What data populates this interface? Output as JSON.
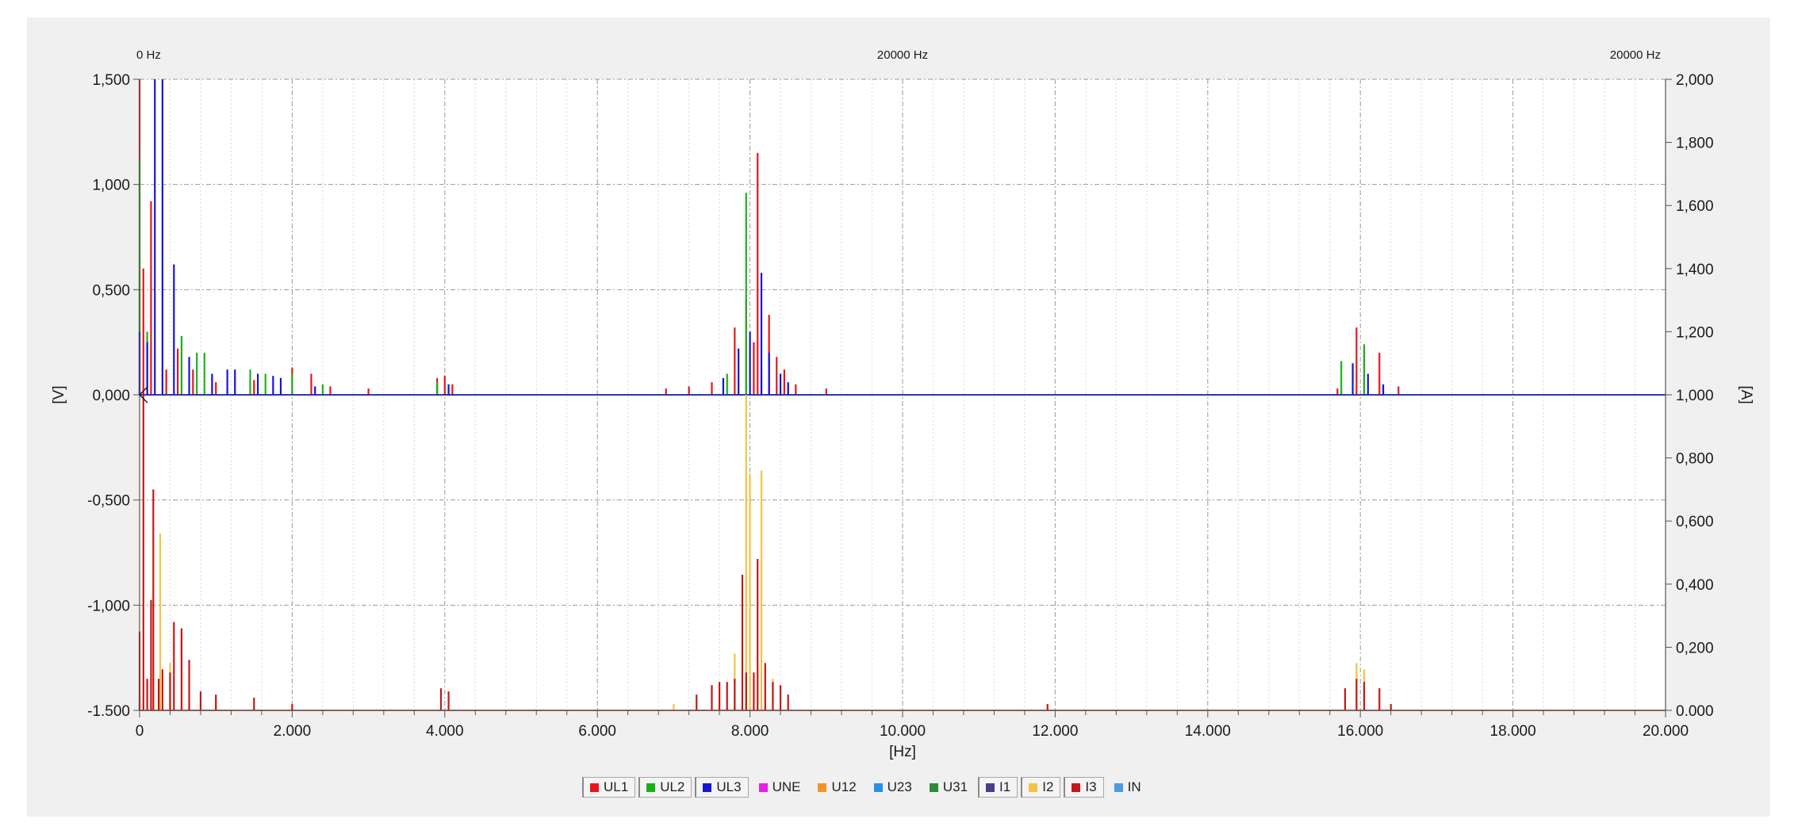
{
  "top_labels": {
    "left": "0 Hz",
    "center": "20000 Hz",
    "right": "20000 Hz"
  },
  "chart_data": {
    "type": "bar",
    "xlabel": "[Hz]",
    "ylabel_left": "[V]",
    "ylabel_right": "[A]",
    "xlim": [
      0,
      20000
    ],
    "ylim_left": [
      -1.5,
      1.5
    ],
    "ylim_right": [
      0,
      2
    ],
    "grid": true,
    "legend_position": "bottom",
    "x_ticks": [
      {
        "value": 0,
        "label": "0"
      },
      {
        "value": 2000,
        "label": "2.000"
      },
      {
        "value": 4000,
        "label": "4.000"
      },
      {
        "value": 6000,
        "label": "6.000"
      },
      {
        "value": 8000,
        "label": "8.000"
      },
      {
        "value": 10000,
        "label": "10.000"
      },
      {
        "value": 12000,
        "label": "12.000"
      },
      {
        "value": 14000,
        "label": "14.000"
      },
      {
        "value": 16000,
        "label": "16.000"
      },
      {
        "value": 18000,
        "label": "18.000"
      },
      {
        "value": 20000,
        "label": "20.000"
      }
    ],
    "y_ticks_left": [
      {
        "value": 1.5,
        "label": "1,500"
      },
      {
        "value": 1.0,
        "label": "1,000"
      },
      {
        "value": 0.5,
        "label": "0,500"
      },
      {
        "value": 0.0,
        "label": "0,000"
      },
      {
        "value": -0.5,
        "label": "-0,500"
      },
      {
        "value": -1.0,
        "label": "-1,000"
      },
      {
        "value": -1.5,
        "label": "-1.500"
      }
    ],
    "y_ticks_right": [
      {
        "value": 2.0,
        "label": "2,000"
      },
      {
        "value": 1.8,
        "label": "1,800"
      },
      {
        "value": 1.6,
        "label": "1,600"
      },
      {
        "value": 1.4,
        "label": "1,400"
      },
      {
        "value": 1.2,
        "label": "1,200"
      },
      {
        "value": 1.0,
        "label": "1,000"
      },
      {
        "value": 0.8,
        "label": "0,800"
      },
      {
        "value": 0.6,
        "label": "0,600"
      },
      {
        "value": 0.4,
        "label": "0,400"
      },
      {
        "value": 0.2,
        "label": "0,200"
      },
      {
        "value": 0.0,
        "label": "0.000"
      }
    ],
    "series": [
      {
        "name": "UL1",
        "axis": "left",
        "color": "#e8161b",
        "points": [
          [
            0,
            1.5
          ],
          [
            50,
            0.6
          ],
          [
            150,
            0.92
          ],
          [
            350,
            0.12
          ],
          [
            500,
            0.22
          ],
          [
            700,
            0.12
          ],
          [
            1000,
            0.06
          ],
          [
            1500,
            0.07
          ],
          [
            2000,
            0.13
          ],
          [
            2250,
            0.1
          ],
          [
            2500,
            0.04
          ],
          [
            3000,
            0.03
          ],
          [
            3900,
            0.08
          ],
          [
            4000,
            0.09
          ],
          [
            4100,
            0.05
          ],
          [
            6900,
            0.03
          ],
          [
            7200,
            0.04
          ],
          [
            7500,
            0.06
          ],
          [
            7800,
            0.32
          ],
          [
            7950,
            0.45
          ],
          [
            8050,
            0.25
          ],
          [
            8100,
            1.15
          ],
          [
            8250,
            0.38
          ],
          [
            8350,
            0.18
          ],
          [
            8450,
            0.12
          ],
          [
            8600,
            0.05
          ],
          [
            9000,
            0.03
          ],
          [
            15700,
            0.03
          ],
          [
            15950,
            0.32
          ],
          [
            16050,
            0.22
          ],
          [
            16250,
            0.2
          ],
          [
            16500,
            0.04
          ]
        ]
      },
      {
        "name": "UL2",
        "axis": "left",
        "color": "#18b218",
        "points": [
          [
            0,
            1.12
          ],
          [
            100,
            0.3
          ],
          [
            550,
            0.28
          ],
          [
            750,
            0.2
          ],
          [
            850,
            0.2
          ],
          [
            1450,
            0.12
          ],
          [
            1650,
            0.1
          ],
          [
            2000,
            0.1
          ],
          [
            2400,
            0.05
          ],
          [
            3900,
            0.06
          ],
          [
            7700,
            0.1
          ],
          [
            7950,
            0.96
          ],
          [
            8150,
            0.12
          ],
          [
            8500,
            0.05
          ],
          [
            15750,
            0.16
          ],
          [
            16050,
            0.24
          ]
        ]
      },
      {
        "name": "UL3",
        "axis": "left",
        "color": "#1515d8",
        "points": [
          [
            0,
            0.3
          ],
          [
            100,
            0.25
          ],
          [
            200,
            1.5
          ],
          [
            300,
            1.5
          ],
          [
            450,
            0.62
          ],
          [
            650,
            0.18
          ],
          [
            950,
            0.1
          ],
          [
            1150,
            0.12
          ],
          [
            1250,
            0.12
          ],
          [
            1550,
            0.1
          ],
          [
            1750,
            0.09
          ],
          [
            1850,
            0.08
          ],
          [
            2300,
            0.04
          ],
          [
            4050,
            0.05
          ],
          [
            7650,
            0.08
          ],
          [
            7850,
            0.22
          ],
          [
            8000,
            0.3
          ],
          [
            8150,
            0.58
          ],
          [
            8250,
            0.2
          ],
          [
            8400,
            0.1
          ],
          [
            8500,
            0.06
          ],
          [
            15900,
            0.15
          ],
          [
            16100,
            0.1
          ],
          [
            16300,
            0.05
          ]
        ]
      },
      {
        "name": "I2",
        "axis": "right",
        "color": "#f5c242",
        "points": [
          [
            0,
            0.05
          ],
          [
            150,
            0.1
          ],
          [
            270,
            0.56
          ],
          [
            400,
            0.15
          ],
          [
            1000,
            0.03
          ],
          [
            7000,
            0.02
          ],
          [
            7800,
            0.18
          ],
          [
            7950,
            1.0
          ],
          [
            8000,
            0.75
          ],
          [
            8150,
            0.76
          ],
          [
            8300,
            0.1
          ],
          [
            15950,
            0.15
          ],
          [
            16050,
            0.13
          ]
        ]
      },
      {
        "name": "I3",
        "axis": "right",
        "color": "#c41818",
        "points": [
          [
            0,
            0.25
          ],
          [
            50,
            1.0
          ],
          [
            100,
            0.1
          ],
          [
            150,
            0.35
          ],
          [
            180,
            0.7
          ],
          [
            250,
            0.1
          ],
          [
            300,
            0.13
          ],
          [
            400,
            0.12
          ],
          [
            450,
            0.28
          ],
          [
            550,
            0.26
          ],
          [
            650,
            0.16
          ],
          [
            800,
            0.06
          ],
          [
            1000,
            0.05
          ],
          [
            1500,
            0.04
          ],
          [
            2000,
            0.02
          ],
          [
            3950,
            0.07
          ],
          [
            4050,
            0.06
          ],
          [
            7300,
            0.05
          ],
          [
            7500,
            0.08
          ],
          [
            7600,
            0.09
          ],
          [
            7700,
            0.09
          ],
          [
            7800,
            0.1
          ],
          [
            7900,
            0.43
          ],
          [
            7950,
            0.12
          ],
          [
            8050,
            0.12
          ],
          [
            8100,
            0.48
          ],
          [
            8200,
            0.15
          ],
          [
            8300,
            0.09
          ],
          [
            8400,
            0.08
          ],
          [
            8500,
            0.05
          ],
          [
            11900,
            0.02
          ],
          [
            15800,
            0.07
          ],
          [
            15950,
            0.1
          ],
          [
            16050,
            0.09
          ],
          [
            16250,
            0.07
          ],
          [
            16400,
            0.02
          ]
        ]
      }
    ]
  },
  "legend": [
    {
      "label": "UL1",
      "color": "#e8161b",
      "active": true
    },
    {
      "label": "UL2",
      "color": "#18b218",
      "active": true
    },
    {
      "label": "UL3",
      "color": "#1515d8",
      "active": true
    },
    {
      "label": "UNE",
      "color": "#e620e6",
      "active": false
    },
    {
      "label": "U12",
      "color": "#f59322",
      "active": false
    },
    {
      "label": "U23",
      "color": "#2b8fe6",
      "active": false
    },
    {
      "label": "U31",
      "color": "#2e8b3a",
      "active": false
    },
    {
      "label": "I1",
      "color": "#4f3a8c",
      "active": true
    },
    {
      "label": "I2",
      "color": "#f5c242",
      "active": true
    },
    {
      "label": "I3",
      "color": "#c41818",
      "active": true
    },
    {
      "label": "IN",
      "color": "#4a9be0",
      "active": false
    }
  ]
}
